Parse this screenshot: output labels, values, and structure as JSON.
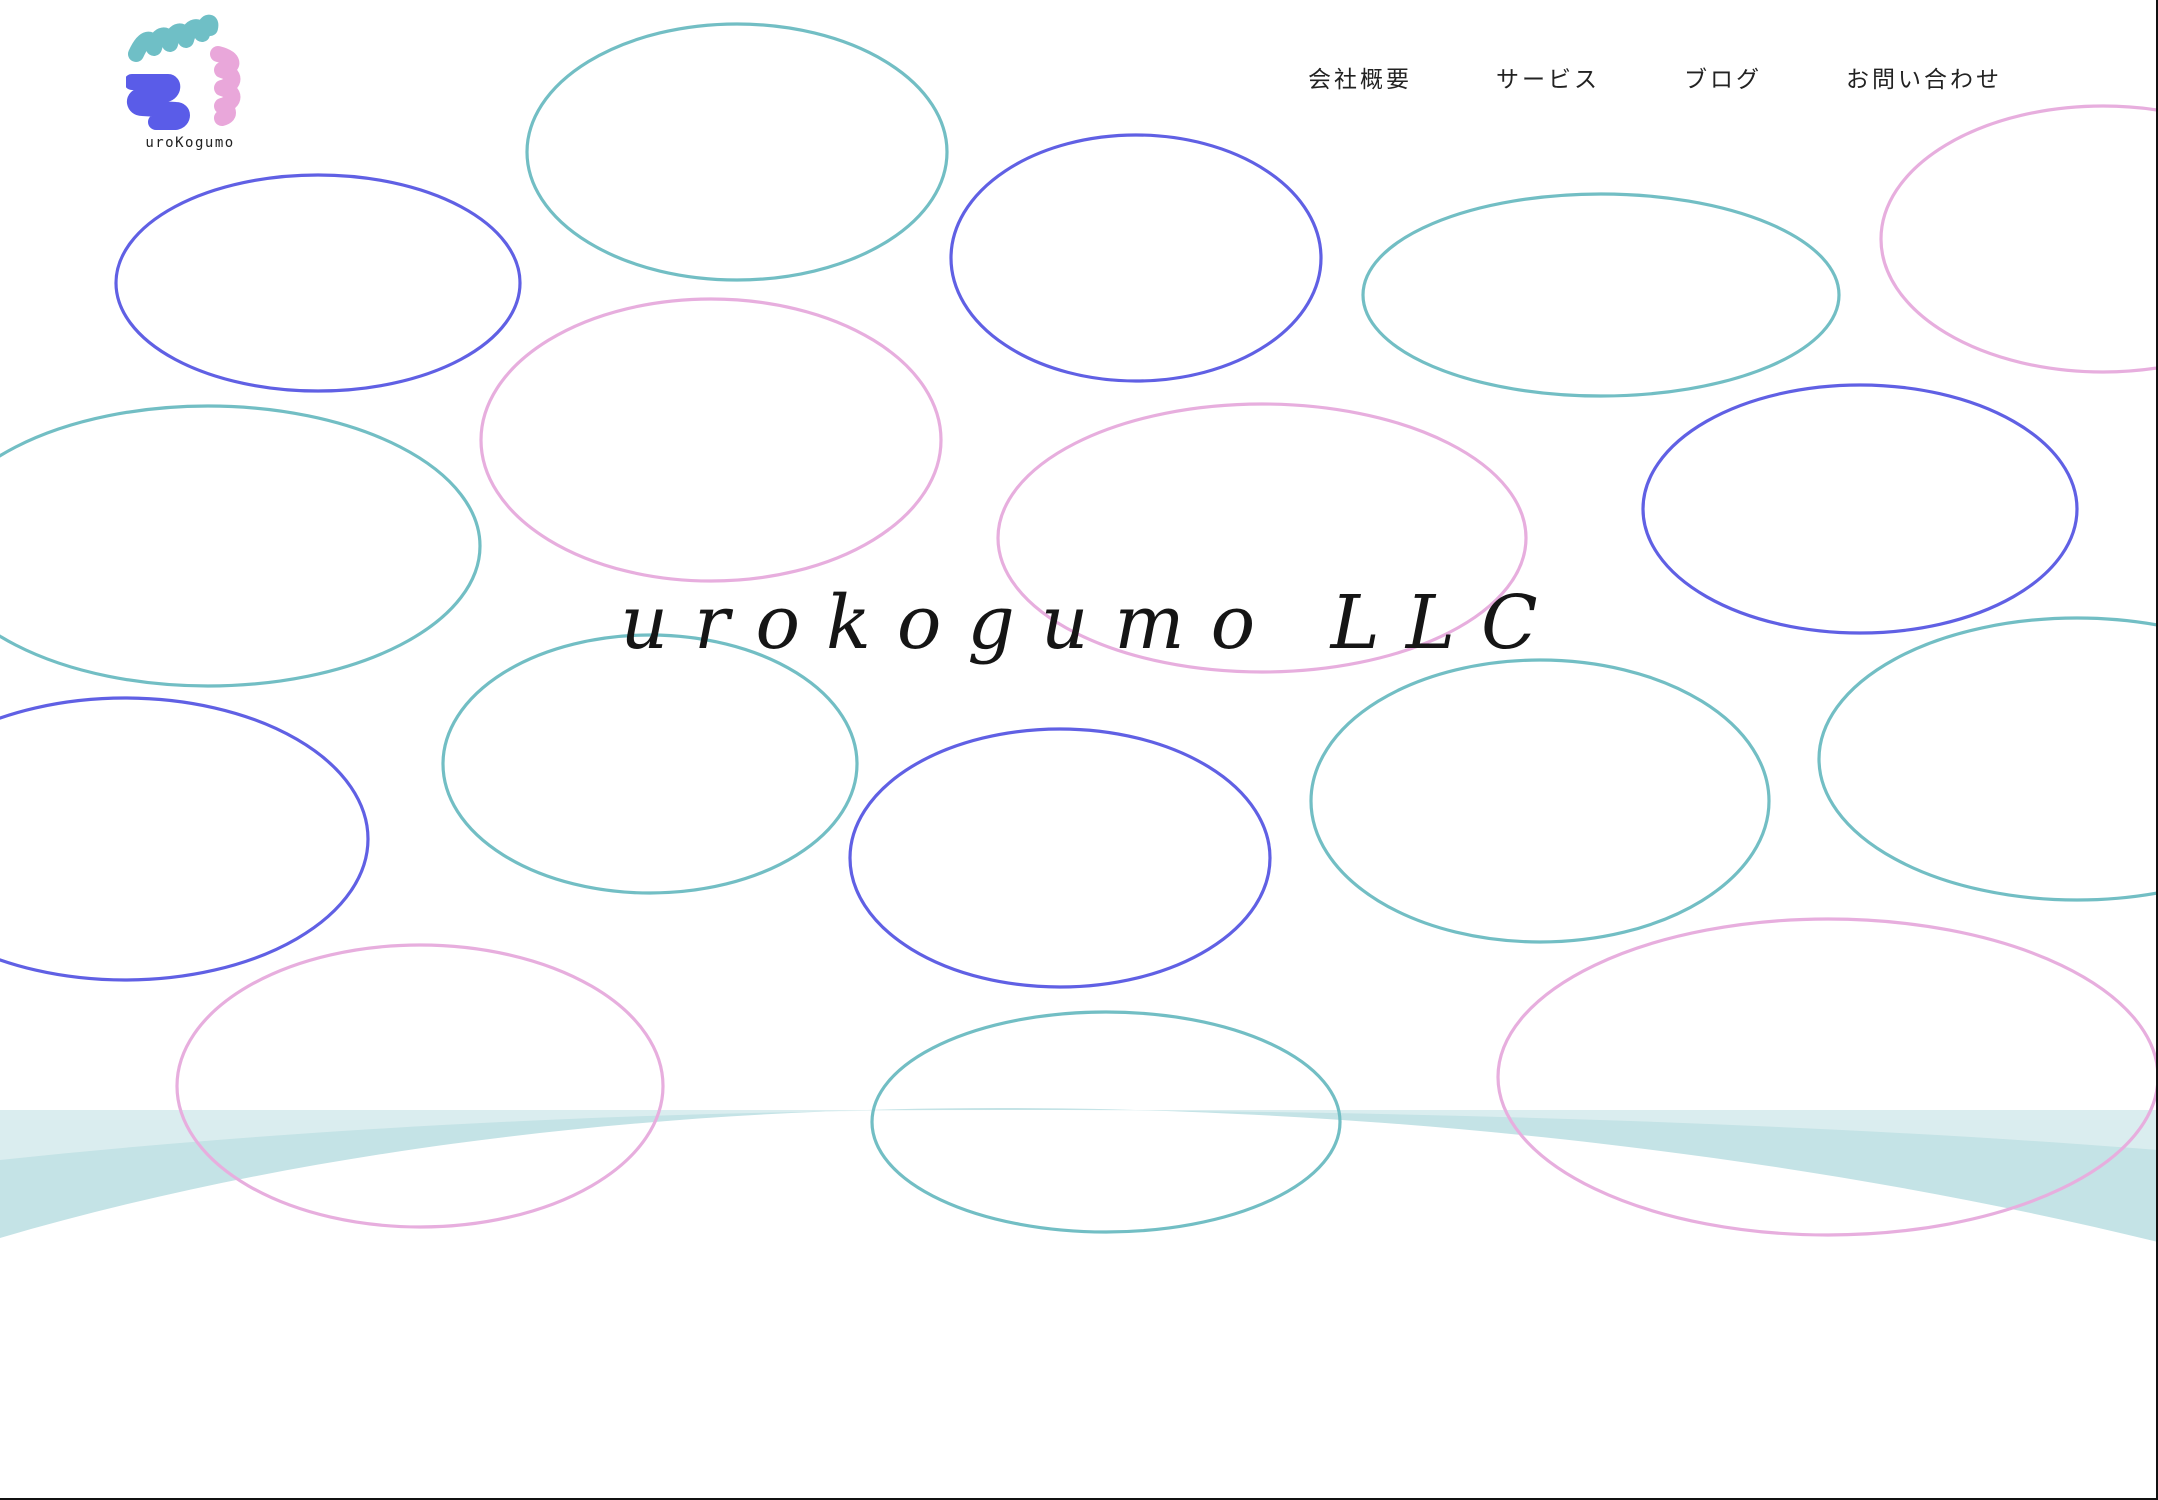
{
  "logo": {
    "text": "uroKogumo",
    "icon": "cloud-scales-logo",
    "colors": {
      "teal": "#6fbfc6",
      "blue": "#5a5ce8",
      "pink": "#e9a7da"
    }
  },
  "nav": {
    "items": [
      {
        "label": "会社概要"
      },
      {
        "label": "サービス"
      },
      {
        "label": "ブログ"
      },
      {
        "label": "お問い合わせ"
      }
    ]
  },
  "hero": {
    "title": "urokogumo LLC"
  },
  "colors": {
    "teal_ring": "#72bec4",
    "blue_ring": "#6060e4",
    "pink_ring": "#e7aede",
    "wave_fill": "#c4e3e6",
    "wave_light": "#e2f0f2",
    "text": "#222222"
  }
}
